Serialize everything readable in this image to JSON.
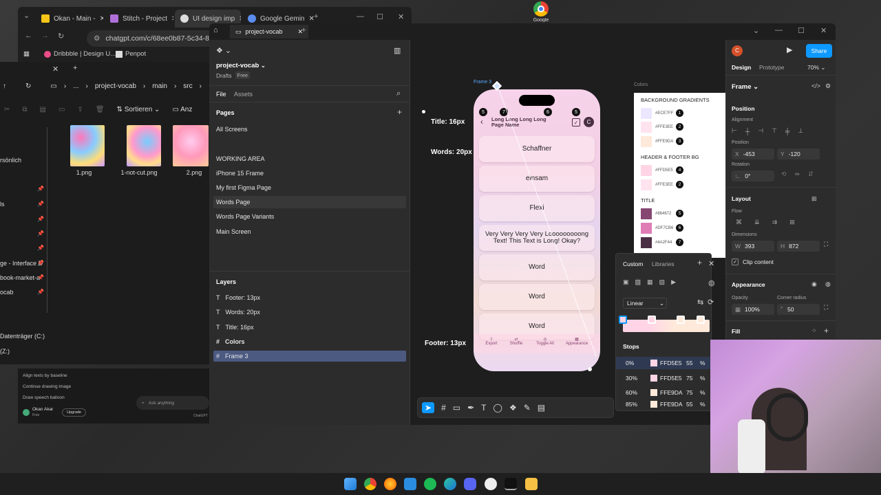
{
  "desktop": {
    "chrome_icon_label": "Google"
  },
  "chrome": {
    "tabs": [
      {
        "label": "Okan - Main -"
      },
      {
        "label": "Stitch - Project"
      },
      {
        "label": "UI design imp"
      },
      {
        "label": "Google Gemin"
      }
    ],
    "url": "chatgpt.com/c/68ee0b87-5c34-8331-9691",
    "bookmarks": [
      {
        "label": "Dribbble | Design U..."
      },
      {
        "label": "Penpot"
      }
    ]
  },
  "explorer": {
    "breadcrumb": [
      "...",
      "project-vocab",
      "main",
      "src"
    ],
    "sort_label": "Sortieren",
    "view_label": "Anz",
    "files": [
      {
        "name": "1.png"
      },
      {
        "name": "1-not-cut.png"
      },
      {
        "name": "2.png"
      }
    ],
    "sidebar": [
      "rsönlich",
      "",
      "ls",
      "",
      "",
      "",
      "ge - Interface D",
      "book-market-a",
      "ocab"
    ],
    "drives": [
      "Datenträger (C:)",
      "(Z:)"
    ]
  },
  "chatgpt": {
    "items": [
      "Align texts by baseline",
      "Continue drawing image",
      "Draw speech balloon"
    ],
    "user": "Okan Akar",
    "plan": "Free",
    "upgrade": "Upgrade",
    "ask": "Ask anything",
    "brand": "ChatGPT"
  },
  "figma": {
    "tab_label": "project-vocab",
    "project_name": "project-vocab",
    "drafts": "Drafts",
    "free_badge": "Free",
    "file_tab": "File",
    "assets_tab": "Assets",
    "pages_header": "Pages",
    "pages": [
      "All Screens",
      "",
      "WORKING AREA",
      "iPhone 15 Frame",
      "My first Figma Page",
      "Words Page",
      "Words Page Variants",
      "Main Screen"
    ],
    "layers_header": "Layers",
    "layers": [
      {
        "icon": "T",
        "label": "Footer: 13px"
      },
      {
        "icon": "T",
        "label": "Words: 20px"
      },
      {
        "icon": "T",
        "label": "Title: 16px"
      },
      {
        "icon": "#",
        "label": "Colors"
      },
      {
        "icon": "#",
        "label": "Frame 3"
      }
    ],
    "canvas": {
      "frame_label": "Frame 3",
      "title_note": "Title: 16px",
      "words_note": "Words: 20px",
      "footer_note": "Footer: 13px",
      "phone_title": "Long Long Long Long Page Name",
      "avatar": "C",
      "words": [
        "Schaffner",
        "einsam",
        "Flexi",
        "Very Very Very Very Looooooooong Text! This Text is Long! Okay?",
        "Word",
        "Word",
        "Word"
      ],
      "footer": [
        "Export",
        "Shuffle",
        "Toggle All",
        "Appearance"
      ],
      "markers": [
        "5",
        "7",
        "6",
        "5"
      ]
    },
    "colors_frame": {
      "label": "Colors",
      "sections": [
        {
          "title": "BACKGROUND GRADIENTS",
          "items": [
            {
              "hex": "#ECE7FF",
              "color": "#ECE7FF",
              "n": "1"
            },
            {
              "hex": "#FFE3EE",
              "color": "#FFE3EE",
              "n": "2"
            },
            {
              "hex": "#FFE9DA",
              "color": "#FFE9DA",
              "n": "3"
            }
          ]
        },
        {
          "title": "HEADER & FOOTER BG",
          "items": [
            {
              "hex": "#FFD5E5",
              "color": "#FFD5E5",
              "n": "4"
            },
            {
              "hex": "#FFE3EE",
              "color": "#FFE3EE",
              "n": "2"
            }
          ]
        },
        {
          "title": "TITLE",
          "items": [
            {
              "hex": "#864672",
              "color": "#864672",
              "n": "5"
            },
            {
              "hex": "#DF7CB6",
              "color": "#DF7CB6",
              "n": "6"
            },
            {
              "hex": "#4A2F44",
              "color": "#4A2F44",
              "n": "7"
            }
          ]
        }
      ]
    },
    "gradient_popup": {
      "tabs": [
        "Custom",
        "Libraries"
      ],
      "type": "Linear",
      "stops_label": "Stops",
      "stops": [
        {
          "pos": "0%",
          "hex": "FFD5E5",
          "color": "#FFD5E5",
          "opacity": "55",
          "pct": "%"
        },
        {
          "pos": "30%",
          "hex": "FFD5E5",
          "color": "#FFD5E5",
          "opacity": "75",
          "pct": "%"
        },
        {
          "pos": "60%",
          "hex": "FFE9DA",
          "color": "#FFE9DA",
          "opacity": "75",
          "pct": "%"
        },
        {
          "pos": "85%",
          "hex": "FFE9DA",
          "color": "#FFE9DA",
          "opacity": "55",
          "pct": "%"
        }
      ]
    },
    "right": {
      "avatar": "C",
      "share": "Share",
      "design_tab": "Design",
      "prototype_tab": "Prototype",
      "zoom": "70%",
      "frame_label": "Frame",
      "position": "Position",
      "alignment": "Alignment",
      "pos_label": "Position",
      "x_label": "X",
      "x": "-453",
      "y_label": "Y",
      "y": "-120",
      "rotation": "Rotation",
      "rot": "0°",
      "layout": "Layout",
      "flow": "Flow",
      "dimensions": "Dimensions",
      "w_label": "W",
      "w": "393",
      "h_label": "H",
      "h": "872",
      "clip": "Clip content",
      "appearance": "Appearance",
      "opacity_label": "Opacity",
      "corner_label": "Corner radius",
      "opacity": "100%",
      "corner": "50",
      "fill": "Fill"
    }
  },
  "colors": {
    "accent": "#0d99ff",
    "figma_bg": "#2c2c2c",
    "canvas": "#1e1e1e"
  }
}
